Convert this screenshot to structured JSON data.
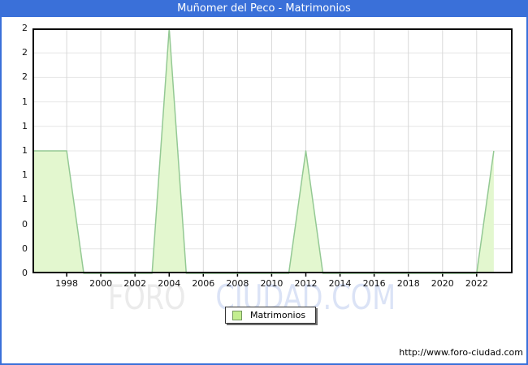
{
  "window": {
    "title": "Muñomer del Peco - Matrimonios"
  },
  "legend": {
    "label": "Matrimonios",
    "swatch_color": "#c3ee90"
  },
  "watermark": {
    "part1": "FORO",
    "part2": "CIUDAD.COM"
  },
  "footer": {
    "url": "http://www.foro-ciudad.com"
  },
  "colors": {
    "accent_blue": "#3a70d9",
    "area_fill": "#e3f7cf",
    "area_line": "#94c994",
    "grid_vertical": "#d8d8d8",
    "grid_horizontal": "#e6e6e6",
    "plot_border": "#000000"
  },
  "chart_data": {
    "type": "area",
    "title": "Muñomer del Peco - Matrimonios",
    "xlabel": "",
    "ylabel": "",
    "grid": true,
    "legend_position": "bottom-center",
    "xlim": [
      1996,
      2024.1
    ],
    "ylim": [
      0,
      2
    ],
    "series": [
      {
        "name": "Matrimonios",
        "x": [
          1996,
          1997,
          1998,
          1999,
          2000,
          2001,
          2002,
          2003,
          2004,
          2005,
          2006,
          2007,
          2008,
          2009,
          2010,
          2011,
          2012,
          2013,
          2014,
          2015,
          2016,
          2017,
          2018,
          2019,
          2020,
          2021,
          2022,
          2023
        ],
        "values": [
          1,
          1,
          1,
          0,
          0,
          0,
          0,
          0,
          2,
          0,
          0,
          0,
          0,
          0,
          0,
          0,
          1,
          0,
          0,
          0,
          0,
          0,
          0,
          0,
          0,
          0,
          0,
          1
        ]
      }
    ],
    "x_tick_years": [
      1998,
      2000,
      2002,
      2004,
      2006,
      2008,
      2010,
      2012,
      2014,
      2016,
      2018,
      2020,
      2022
    ],
    "y_tick_step": 0.2,
    "y_tick_values": [
      2.0,
      1.8,
      1.6,
      1.4,
      1.2,
      1.0,
      0.8,
      0.6,
      0.4,
      0.2,
      0.0
    ],
    "y_tick_labels": [
      "2",
      "2",
      "2",
      "1",
      "1",
      "1",
      "1",
      "1",
      "0",
      "0",
      "0"
    ]
  }
}
